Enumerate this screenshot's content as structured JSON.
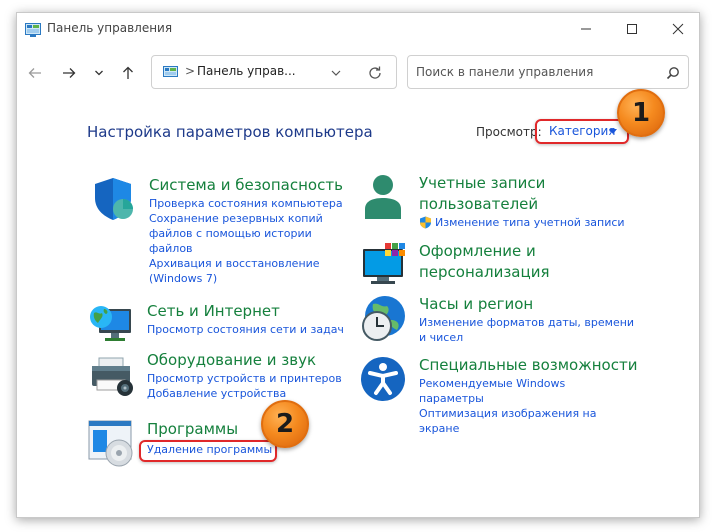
{
  "window": {
    "title": "Панель управления"
  },
  "address": {
    "separator": ">",
    "path": "Панель управ..."
  },
  "search": {
    "placeholder": "Поиск в панели управления"
  },
  "content": {
    "heading": "Настройка параметров компьютера",
    "view_by_label": "Просмотр:",
    "view_by_value": "Категория"
  },
  "badges": [
    "1",
    "2"
  ],
  "left_categories": [
    {
      "title": "Система и безопасность",
      "icon": "shield-icon",
      "links": [
        "Проверка состояния компьютера",
        "Сохранение резервных копий",
        "файлов с помощью истории",
        "файлов",
        "Архивация и восстановление",
        "(Windows 7)"
      ]
    },
    {
      "title": "Сеть и Интернет",
      "icon": "network-globe-icon",
      "links": [
        "Просмотр состояния сети и задач"
      ]
    },
    {
      "title": "Оборудование и звук",
      "icon": "printer-icon",
      "links": [
        "Просмотр устройств и принтеров",
        "Добавление устройства"
      ]
    },
    {
      "title": "Программы",
      "icon": "programs-disc-icon",
      "links": [
        "Удаление программы"
      ]
    }
  ],
  "right_categories": [
    {
      "title_lines": [
        "Учетные записи",
        "пользователей"
      ],
      "icon": "user-accounts-icon",
      "links": [
        "Изменение типа учетной записи"
      ],
      "link_icon": "uac-shield-icon"
    },
    {
      "title_lines": [
        "Оформление и",
        "персонализация"
      ],
      "icon": "monitor-personalization-icon",
      "links": []
    },
    {
      "title_lines": [
        "Часы и регион"
      ],
      "icon": "clock-globe-icon",
      "links": [
        "Изменение форматов даты, времени",
        "и чисел"
      ]
    },
    {
      "title_lines": [
        "Специальные возможности"
      ],
      "icon": "accessibility-icon",
      "links": [
        "Рекомендуемые Windows",
        "параметры",
        "Оптимизация изображения на",
        "экране"
      ]
    }
  ],
  "colors": {
    "heading": "#1e3a8a",
    "category_title": "#15803d",
    "link": "#1a56db",
    "highlight": "#e0282a",
    "badge": "#f58a1f"
  }
}
